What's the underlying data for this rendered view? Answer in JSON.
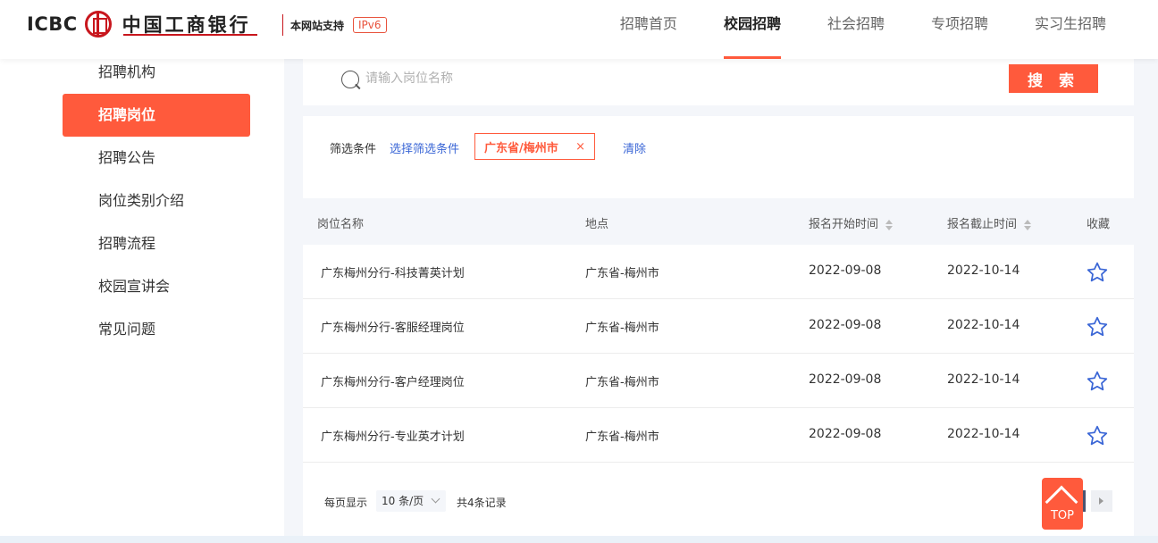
{
  "header": {
    "logo_en": "ICBC",
    "logo_cn": "中国工商银行",
    "support_text": "本网站支持",
    "ipv6_badge": "IPv6",
    "nav": [
      {
        "label": "招聘首页",
        "active": false
      },
      {
        "label": "校园招聘",
        "active": true
      },
      {
        "label": "社会招聘",
        "active": false
      },
      {
        "label": "专项招聘",
        "active": false
      },
      {
        "label": "实习生招聘",
        "active": false
      }
    ]
  },
  "sidebar": {
    "items": [
      {
        "label": "招聘机构"
      },
      {
        "label": "招聘岗位",
        "active": true
      },
      {
        "label": "招聘公告"
      },
      {
        "label": "岗位类别介绍"
      },
      {
        "label": "招聘流程"
      },
      {
        "label": "校园宣讲会"
      },
      {
        "label": "常见问题"
      }
    ]
  },
  "search": {
    "placeholder": "请输入岗位名称",
    "value": "",
    "button_label": "搜 索"
  },
  "filter": {
    "label": "筛选条件",
    "select_link": "选择筛选条件",
    "tag": "广东省/梅州市",
    "tag_close": "×",
    "clear_link": "清除"
  },
  "table": {
    "headers": {
      "title": "岗位名称",
      "location": "地点",
      "start": "报名开始时间",
      "end": "报名截止时间",
      "favorite": "收藏"
    },
    "rows": [
      {
        "title": "广东梅州分行-科技菁英计划",
        "location": "广东省-梅州市",
        "start": "2022-09-08",
        "end": "2022-10-14"
      },
      {
        "title": "广东梅州分行-客服经理岗位",
        "location": "广东省-梅州市",
        "start": "2022-09-08",
        "end": "2022-10-14"
      },
      {
        "title": "广东梅州分行-客户经理岗位",
        "location": "广东省-梅州市",
        "start": "2022-09-08",
        "end": "2022-10-14"
      },
      {
        "title": "广东梅州分行-专业英才计划",
        "location": "广东省-梅州市",
        "start": "2022-09-08",
        "end": "2022-10-14"
      }
    ]
  },
  "pager": {
    "per_page_label": "每页显示",
    "page_size": "10 条/页",
    "total": "共4条记录"
  },
  "top_button": {
    "label": "TOP"
  },
  "colors": {
    "accent": "#ff5a3c",
    "link": "#3a66d6",
    "brand_red": "#c8161d",
    "star": "#3a66d6"
  },
  "icons": [
    "search-icon",
    "star-outline-icon",
    "close-icon",
    "chevron-down-icon",
    "chevron-right-icon",
    "arrow-up-icon"
  ]
}
